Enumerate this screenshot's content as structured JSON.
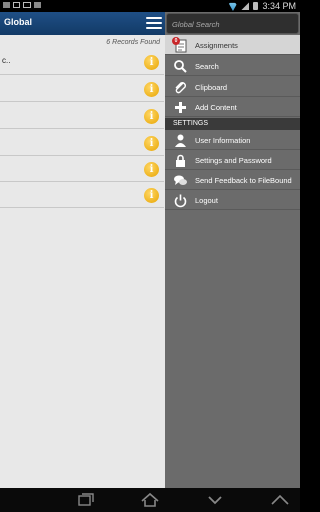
{
  "status_bar": {
    "time": "3:34 PM"
  },
  "header": {
    "title": "Global"
  },
  "list": {
    "records_label": "6 Records Found",
    "rows": [
      {
        "text": "c.."
      },
      {
        "text": ""
      },
      {
        "text": ""
      },
      {
        "text": ""
      },
      {
        "text": ""
      },
      {
        "text": ""
      }
    ]
  },
  "drawer": {
    "search_placeholder": "Global Search",
    "items": [
      {
        "label": "Assignments",
        "icon": "assignments-icon",
        "badge": "0"
      },
      {
        "label": "Search",
        "icon": "search-icon"
      },
      {
        "label": "Clipboard",
        "icon": "paperclip-icon"
      },
      {
        "label": "Add Content",
        "icon": "plus-icon"
      }
    ],
    "settings_header": "SETTINGS",
    "settings_items": [
      {
        "label": "User Information",
        "icon": "user-icon"
      },
      {
        "label": "Settings and Password",
        "icon": "lock-icon"
      },
      {
        "label": "Send Feedback to FileBound",
        "icon": "feedback-icon"
      },
      {
        "label": "Logout",
        "icon": "power-icon"
      }
    ]
  },
  "colors": {
    "header_blue": "#1f4f86",
    "drawer_gray": "#6b6b6b",
    "badge_red": "#c8272a",
    "info_yellow": "#e7a400"
  }
}
